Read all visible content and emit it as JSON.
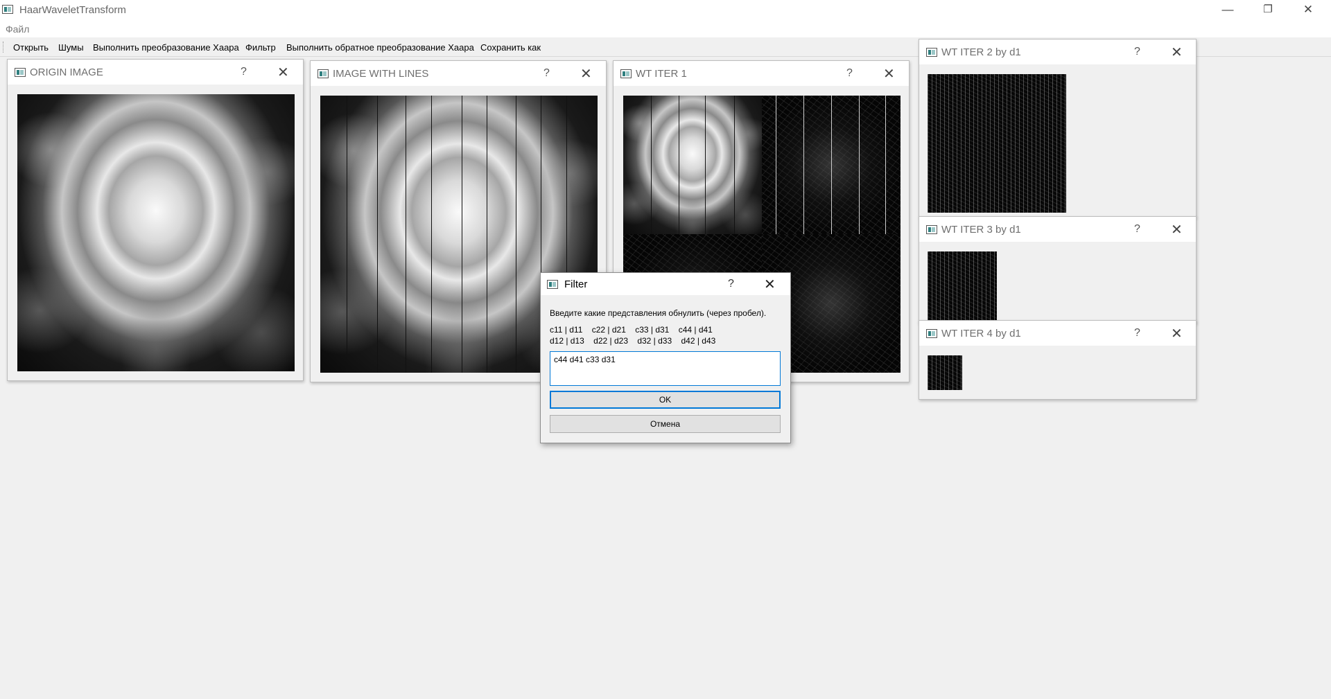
{
  "app": {
    "title": "HaarWaveletTransform",
    "window_controls": {
      "minimize": "—",
      "restore": "❐",
      "close": "✕"
    }
  },
  "menubar": {
    "file_label": "Файл"
  },
  "toolbar": {
    "open": "Открыть",
    "noise": "Шумы",
    "haar_forward": "Выполнить преобразование Хаара",
    "filter": "Фильтр",
    "haar_inverse": "Выполнить обратное преобразование Хаара",
    "save_as": "Сохранить как"
  },
  "subwindows": {
    "origin": {
      "title": "ORIGIN IMAGE"
    },
    "lines": {
      "title": "IMAGE WITH LINES"
    },
    "wt1": {
      "title": "WT ITER 1"
    },
    "wt2": {
      "title": "WT ITER 2 by d1"
    },
    "wt3": {
      "title": "WT ITER 3 by d1"
    },
    "wt4": {
      "title": "WT ITER 4 by d1"
    },
    "help_glyph": "?",
    "close_glyph": "✕"
  },
  "filter_dialog": {
    "title": "Filter",
    "prompt": "Введите какие представления обнулить (через пробел).",
    "legend_row1": "c11 | d11    c22 | d21    c33 | d31    c44 | d41",
    "legend_row2": "d12 | d13    d22 | d23    d32 | d33    d42 | d43",
    "input_value": "c44 d41 c33 d31",
    "ok_label": "OK",
    "cancel_label": "Отмена"
  },
  "icons": {
    "app": "app-window-icon",
    "help": "help-icon",
    "close": "close-icon"
  }
}
